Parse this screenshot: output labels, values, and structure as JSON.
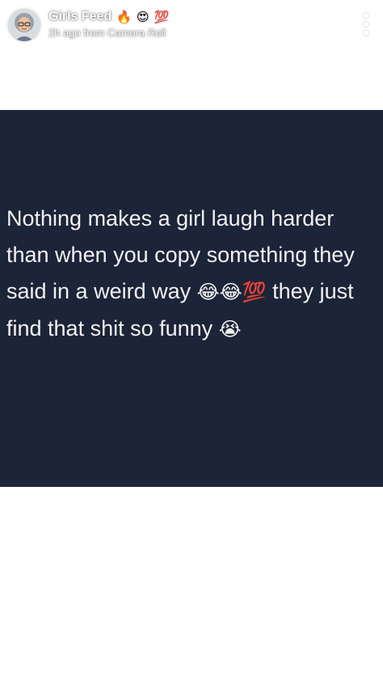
{
  "header": {
    "title": "Girls Feed",
    "title_emojis": [
      "🔥",
      "😍",
      "💯"
    ],
    "subtitle": "2h ago from Camera Roll"
  },
  "post": {
    "background_color": "#1c2438",
    "text_color": "#f2f2f2",
    "lines": [
      {
        "text": "Nothing makes a girl laugh harder"
      },
      {
        "text": "than when you copy something they"
      },
      {
        "before": "said in a weird way ",
        "emojis": "😂😂💯",
        "after": " they just"
      },
      {
        "before": "find that shit so funny ",
        "emojis": "😭",
        "after": ""
      }
    ]
  },
  "icons": {
    "avatar": "bitmoji-avatar",
    "more": "vertical-more-icon"
  }
}
